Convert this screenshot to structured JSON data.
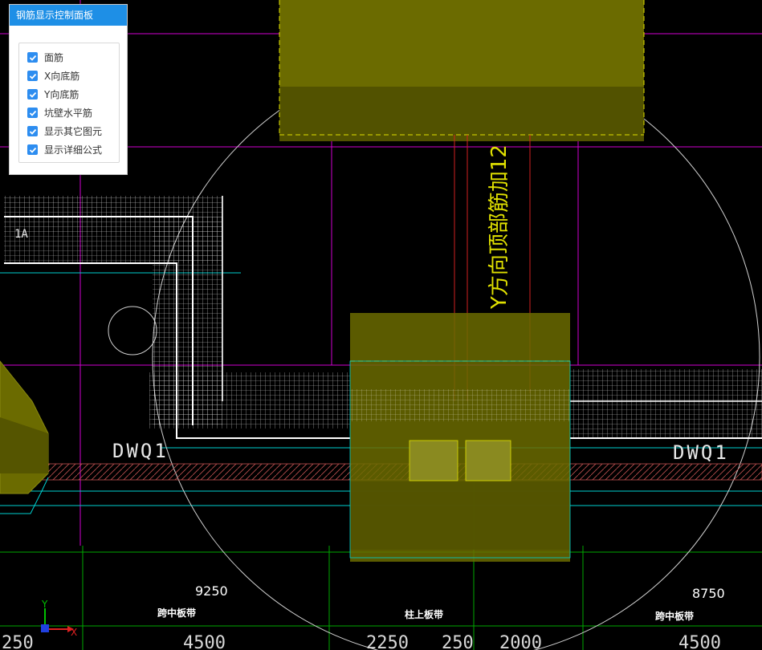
{
  "panel": {
    "title": "钢筋显示控制面板",
    "options": [
      {
        "label": "面筋",
        "checked": true
      },
      {
        "label": "X向底筋",
        "checked": true
      },
      {
        "label": "Y向底筋",
        "checked": true
      },
      {
        "label": "坑壁水平筋",
        "checked": true
      },
      {
        "label": "显示其它图元",
        "checked": true
      },
      {
        "label": "显示详细公式",
        "checked": true
      }
    ]
  },
  "drawing": {
    "wall_label_left": "DWQ1",
    "wall_label_right": "DWQ1",
    "rebar_annotation": "Y方向顶部筋加12",
    "partial_label": "1A",
    "dim_left": "9250",
    "dim_right": "8750",
    "strip_labels": [
      "跨中板带",
      "柱上板带",
      "跨中板带"
    ],
    "bottom_dims": [
      "250",
      "4500",
      "2250",
      "250",
      "2000",
      "4500"
    ]
  },
  "axes": {
    "y": "Y",
    "x": "X"
  },
  "colors": {
    "accent": "#1e8fe6",
    "column_fill": "#6b6b00",
    "magenta": "#d000d0",
    "cyan": "#00d0d0",
    "green": "#00a800",
    "annotation": "#e0e000"
  }
}
